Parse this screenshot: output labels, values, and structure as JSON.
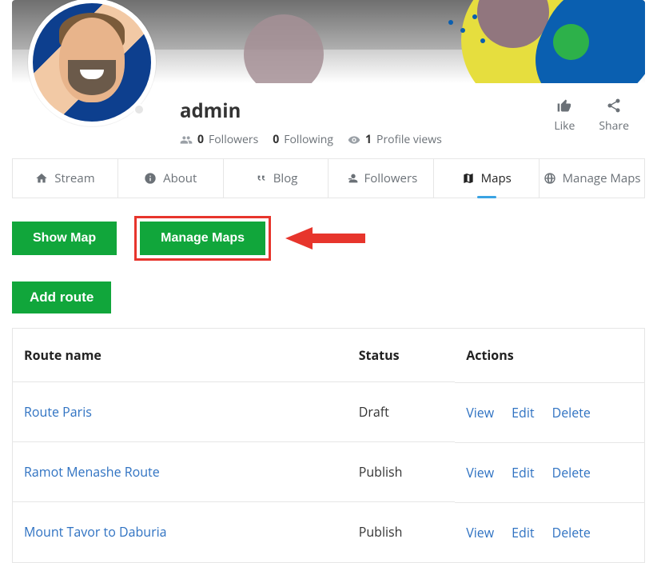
{
  "profile": {
    "username": "admin",
    "followers": {
      "count": "0",
      "label": "Followers"
    },
    "following": {
      "count": "0",
      "label": "Following"
    },
    "views": {
      "count": "1",
      "label": "Profile views"
    }
  },
  "head_actions": {
    "like": "Like",
    "share": "Share"
  },
  "tabs": {
    "stream": "Stream",
    "about": "About",
    "blog": "Blog",
    "followers": "Followers",
    "maps": "Maps",
    "manage_maps": "Manage Maps"
  },
  "buttons": {
    "show_map": "Show Map",
    "manage_maps": "Manage Maps",
    "add_route": "Add route"
  },
  "table": {
    "headers": {
      "route": "Route name",
      "status": "Status",
      "actions": "Actions"
    },
    "action_labels": {
      "view": "View",
      "edit": "Edit",
      "delete": "Delete"
    },
    "rows": [
      {
        "name": "Route Paris",
        "status": "Draft"
      },
      {
        "name": "Ramot Menashe Route",
        "status": "Publish"
      },
      {
        "name": "Mount Tavor to Daburia",
        "status": "Publish"
      }
    ]
  }
}
